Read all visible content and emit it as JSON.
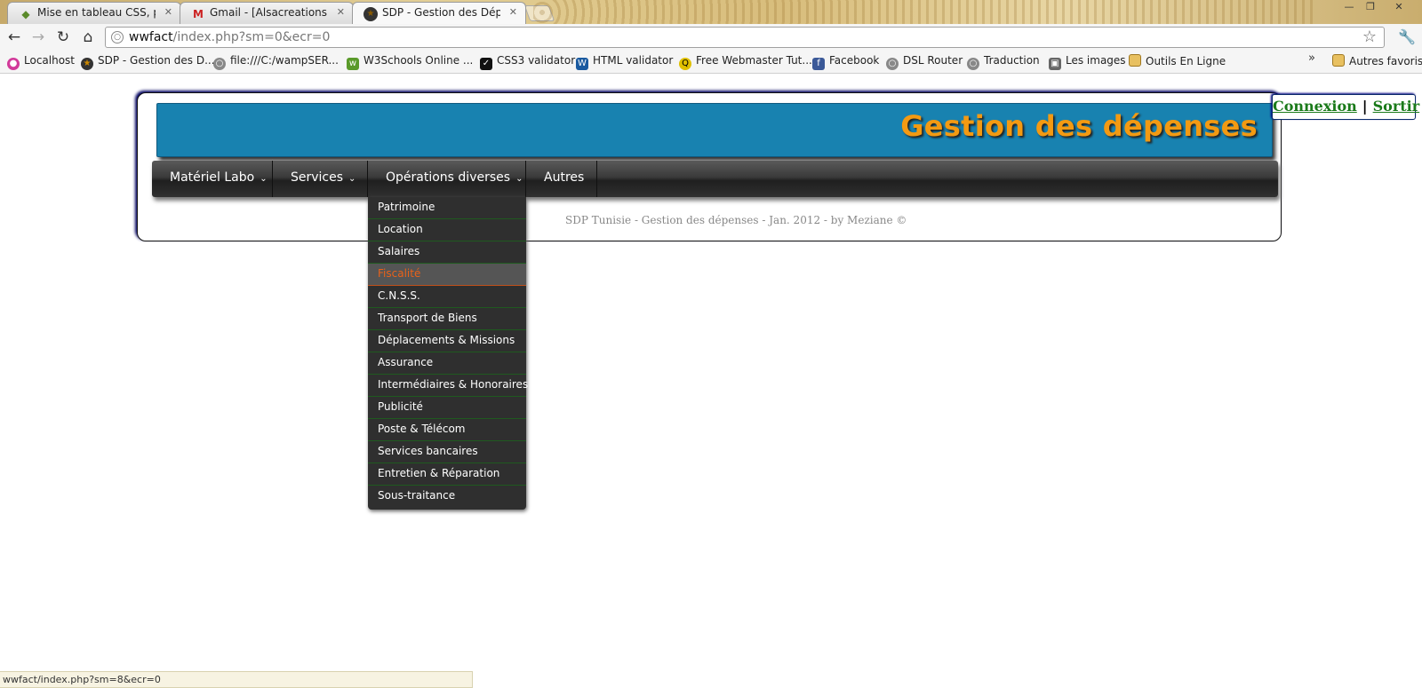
{
  "browser": {
    "tabs": [
      {
        "label": "Mise en tableau CSS, problè",
        "icon": "alsacreations-icon"
      },
      {
        "label": "Gmail - [Alsacreations] Insc",
        "icon": "gmail-icon"
      },
      {
        "label": "SDP - Gestion des Dépenses",
        "icon": "star-badge-icon"
      }
    ],
    "address": {
      "host": "wwfact",
      "path": "/index.php?sm=0&ecr=0"
    },
    "bookmarks": [
      "Localhost",
      "SDP - Gestion des D...",
      "file:///C:/wampSER...",
      "W3Schools Online ...",
      "CSS3 validator",
      "HTML validator",
      "Free Webmaster Tut...",
      "Facebook",
      "DSL Router",
      "Traduction",
      "Les images",
      "Outils En Ligne"
    ],
    "bookmarks_overflow": "»",
    "other_bookmarks": "Autres favoris",
    "status_url": "wwfact/index.php?sm=8&ecr=0"
  },
  "page": {
    "title": "Gestion des dépenses",
    "auth": {
      "login": "Connexion",
      "separator": "|",
      "logout": "Sortir"
    },
    "menu": [
      {
        "label": "Matériel Labo",
        "has_submenu": true
      },
      {
        "label": "Services",
        "has_submenu": true
      },
      {
        "label": "Opérations diverses",
        "has_submenu": true
      },
      {
        "label": "Autres",
        "has_submenu": false
      }
    ],
    "dropdown": {
      "items": [
        "Patrimoine",
        "Location",
        "Salaires",
        "Fiscalité",
        "C.N.S.S.",
        "Transport de Biens",
        "Déplacements & Missions",
        "Assurance",
        "Intermédiaires & Honoraires",
        "Publicité",
        "Poste & Télécom",
        "Services bancaires",
        "Entretien & Réparation",
        "Sous-traitance"
      ],
      "hovered": "Fiscalité"
    },
    "footer": "SDP Tunisie - Gestion des dépenses - Jan. 2012 - by Meziane ©"
  },
  "colors": {
    "banner": "#1882b0",
    "title": "#f39a12",
    "auth_link": "#1a7a1a",
    "menu_bar": "#2a2a2a",
    "dropdown_hover_text": "#e8621a"
  }
}
